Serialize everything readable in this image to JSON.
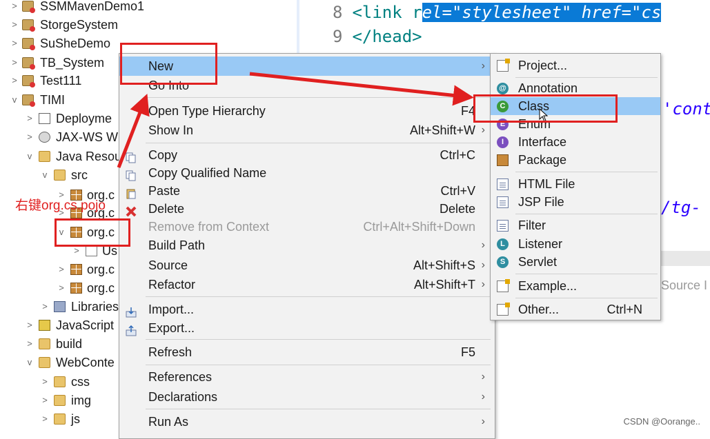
{
  "tree": {
    "items": [
      {
        "label": "SSMMavenDemo1",
        "icon": "project-icon",
        "indent": 0,
        "twisty": ">"
      },
      {
        "label": "StorgeSystem",
        "icon": "project-icon",
        "indent": 0,
        "twisty": ">"
      },
      {
        "label": "SuSheDemo",
        "icon": "project-icon",
        "indent": 0,
        "twisty": ">"
      },
      {
        "label": "TB_System",
        "icon": "project-icon",
        "indent": 0,
        "twisty": ">"
      },
      {
        "label": "Test111",
        "icon": "project-icon",
        "indent": 0,
        "twisty": ">"
      },
      {
        "label": "TIMI",
        "icon": "project-icon",
        "indent": 0,
        "twisty": "v"
      },
      {
        "label": "Deployme",
        "icon": "deployment-icon",
        "indent": 1,
        "twisty": ">"
      },
      {
        "label": "JAX-WS W",
        "icon": "web-service-icon",
        "indent": 1,
        "twisty": ">"
      },
      {
        "label": "Java Resou",
        "icon": "java-resources-icon",
        "indent": 1,
        "twisty": "v"
      },
      {
        "label": "src",
        "icon": "source-folder-icon",
        "indent": 2,
        "twisty": "v"
      },
      {
        "label": "org.c",
        "icon": "package-icon",
        "indent": 3,
        "twisty": ">"
      },
      {
        "label": "org.c",
        "icon": "package-icon",
        "indent": 3,
        "twisty": ">"
      },
      {
        "label": "org.c",
        "icon": "package-icon",
        "indent": 3,
        "twisty": "v"
      },
      {
        "label": "Us",
        "icon": "java-file-icon",
        "indent": 4,
        "twisty": ">"
      },
      {
        "label": "org.c",
        "icon": "package-icon",
        "indent": 3,
        "twisty": ">"
      },
      {
        "label": "org.c",
        "icon": "package-icon",
        "indent": 3,
        "twisty": ">"
      },
      {
        "label": "Libraries",
        "icon": "library-icon",
        "indent": 2,
        "twisty": ">"
      },
      {
        "label": "JavaScript",
        "icon": "javascript-icon",
        "indent": 1,
        "twisty": ">"
      },
      {
        "label": "build",
        "icon": "folder-icon",
        "indent": 1,
        "twisty": ">"
      },
      {
        "label": "WebConte",
        "icon": "folder-icon",
        "indent": 1,
        "twisty": "v"
      },
      {
        "label": "css",
        "icon": "folder-icon",
        "indent": 2,
        "twisty": ">"
      },
      {
        "label": "img",
        "icon": "folder-icon",
        "indent": 2,
        "twisty": ">"
      },
      {
        "label": "js",
        "icon": "folder-icon",
        "indent": 2,
        "twisty": ">"
      }
    ]
  },
  "editor": {
    "line8_num": "8",
    "line8_plain": "<link r",
    "line8_selected": "el=\"stylesheet\" href=\"cs",
    "line9_num": "9",
    "line9_text": "</head>",
    "frag_cont": "'cont",
    "frag_tg": "/tg-",
    "console_source": "Source I",
    "console_bracket": "]"
  },
  "context_menu": {
    "items": [
      {
        "label": "New",
        "shortcut": "",
        "submenu": true,
        "highlighted": true
      },
      {
        "label": "Go Into",
        "shortcut": "",
        "submenu": false
      },
      {
        "label": "Open Type Hierarchy",
        "shortcut": "F4",
        "submenu": false
      },
      {
        "label": "Show In",
        "shortcut": "Alt+Shift+W",
        "submenu": true
      },
      {
        "label": "Copy",
        "shortcut": "Ctrl+C",
        "submenu": false,
        "icon": "copy-icon"
      },
      {
        "label": "Copy Qualified Name",
        "shortcut": "",
        "submenu": false,
        "icon": "copy-icon"
      },
      {
        "label": "Paste",
        "shortcut": "Ctrl+V",
        "submenu": false,
        "icon": "paste-icon"
      },
      {
        "label": "Delete",
        "shortcut": "Delete",
        "submenu": false,
        "icon": "delete-icon"
      },
      {
        "label": "Remove from Context",
        "shortcut": "Ctrl+Alt+Shift+Down",
        "submenu": false,
        "disabled": true
      },
      {
        "label": "Build Path",
        "shortcut": "",
        "submenu": true
      },
      {
        "label": "Source",
        "shortcut": "Alt+Shift+S",
        "submenu": true
      },
      {
        "label": "Refactor",
        "shortcut": "Alt+Shift+T",
        "submenu": true
      },
      {
        "label": "Import...",
        "shortcut": "",
        "submenu": false,
        "icon": "import-icon"
      },
      {
        "label": "Export...",
        "shortcut": "",
        "submenu": false,
        "icon": "export-icon"
      },
      {
        "label": "Refresh",
        "shortcut": "F5",
        "submenu": false
      },
      {
        "label": "References",
        "shortcut": "",
        "submenu": true
      },
      {
        "label": "Declarations",
        "shortcut": "",
        "submenu": true
      },
      {
        "label": "Run As",
        "shortcut": "",
        "submenu": true
      }
    ]
  },
  "submenu": {
    "items": [
      {
        "label": "Project...",
        "shortcut": "",
        "icon": "new-project-icon"
      },
      {
        "label": "Annotation",
        "shortcut": "",
        "icon": "annotation-icon"
      },
      {
        "label": "Class",
        "shortcut": "",
        "icon": "class-icon",
        "highlighted": true
      },
      {
        "label": "Enum",
        "shortcut": "",
        "icon": "enum-icon"
      },
      {
        "label": "Interface",
        "shortcut": "",
        "icon": "interface-icon"
      },
      {
        "label": "Package",
        "shortcut": "",
        "icon": "package-icon"
      },
      {
        "label": "HTML File",
        "shortcut": "",
        "icon": "html-file-icon"
      },
      {
        "label": "JSP File",
        "shortcut": "",
        "icon": "jsp-file-icon"
      },
      {
        "label": "Filter",
        "shortcut": "",
        "icon": "filter-icon"
      },
      {
        "label": "Listener",
        "shortcut": "",
        "icon": "listener-icon"
      },
      {
        "label": "Servlet",
        "shortcut": "",
        "icon": "servlet-icon"
      },
      {
        "label": "Example...",
        "shortcut": "",
        "icon": "example-icon"
      },
      {
        "label": "Other...",
        "shortcut": "Ctrl+N",
        "icon": "other-icon"
      }
    ]
  },
  "annotation": {
    "text": "右键org.cs.pojo",
    "color": "#e02020"
  },
  "watermark": "CSDN @Oorange..",
  "colors": {
    "highlight": "#99c9f5",
    "selection": "#0a7ad6",
    "annotation_red": "#e02020"
  }
}
